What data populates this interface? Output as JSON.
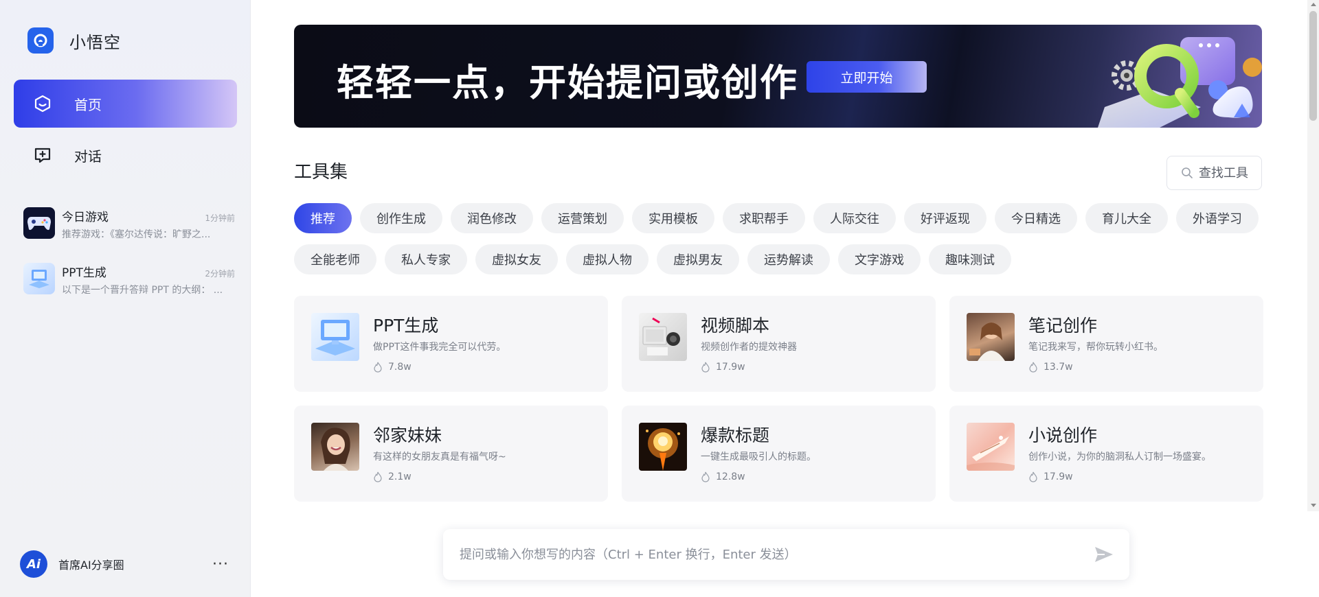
{
  "brand": {
    "name": "小悟空"
  },
  "nav": [
    {
      "label": "首页",
      "icon": "home-hex-icon",
      "active": true
    },
    {
      "label": "对话",
      "icon": "chat-add-icon",
      "active": false
    }
  ],
  "history": [
    {
      "title": "今日游戏",
      "time": "1分钟前",
      "desc": "推荐游戏：《塞尔达传说：旷野之...",
      "icon": "gamepad-thumb"
    },
    {
      "title": "PPT生成",
      "time": "2分钟前",
      "desc": "以下是一个晋升答辩 PPT 的大纲：  ...",
      "icon": "ppt-thumb"
    }
  ],
  "user": {
    "avatar_text": "Ai",
    "name": "首席AI分享圈",
    "more": "···"
  },
  "banner": {
    "title": "轻轻一点，开始提问或创作",
    "button": "立即开始"
  },
  "tools": {
    "title": "工具集",
    "search_placeholder": "查找工具",
    "categories_row1": [
      "推荐",
      "创作生成",
      "润色修改",
      "运营策划",
      "实用模板",
      "求职帮手",
      "人际交往",
      "好评返现",
      "今日精选",
      "育儿大全",
      "外语学习"
    ],
    "categories_row2": [
      "全能老师",
      "私人专家",
      "虚拟女友",
      "虚拟人物",
      "虚拟男友",
      "运势解读",
      "文字游戏",
      "趣味测试"
    ],
    "active_category": "推荐"
  },
  "cards": [
    {
      "title": "PPT生成",
      "desc": "做PPT这件事我完全可以代劳。",
      "count": "7.8w"
    },
    {
      "title": "视频脚本",
      "desc": "视频创作者的提效神器",
      "count": "17.9w"
    },
    {
      "title": "笔记创作",
      "desc": "笔记我来写，帮你玩转小红书。",
      "count": "13.7w"
    },
    {
      "title": "邻家妹妹",
      "desc": "有这样的女朋友真是有福气呀~",
      "count": "2.1w"
    },
    {
      "title": "爆款标题",
      "desc": "一键生成最吸引人的标题。",
      "count": "12.8w"
    },
    {
      "title": "小说创作",
      "desc": "创作小说，为你的脑洞私人订制一场盛宴。",
      "count": "17.9w"
    }
  ],
  "composer": {
    "placeholder": "提问或输入你想写的内容（Ctrl + Enter 换行，Enter 发送）"
  },
  "colors": {
    "accent": "#2f3ee8",
    "sidebar_bg": "#f1f2f6",
    "card_bg": "#f6f6f8"
  }
}
